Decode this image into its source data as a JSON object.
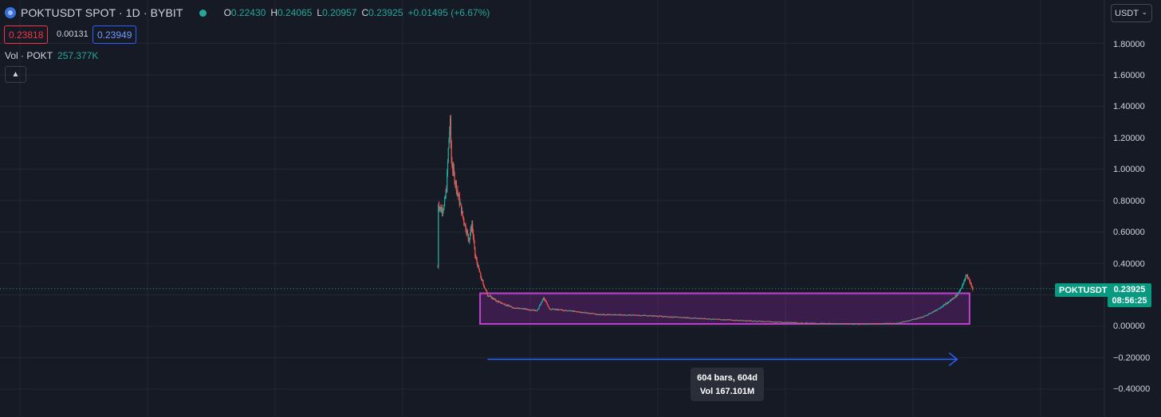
{
  "header": {
    "title": "POKTUSDT SPOT · 1D · BYBIT",
    "ohlc": [
      {
        "key": "O",
        "value": "0.22430"
      },
      {
        "key": "H",
        "value": "0.24065"
      },
      {
        "key": "L",
        "value": "0.20957"
      },
      {
        "key": "C",
        "value": "0.23925"
      }
    ],
    "change": "+0.01495 (+6.67%)"
  },
  "prices": {
    "bid": "0.23818",
    "spread": "0.00131",
    "ask": "0.23949"
  },
  "volume": {
    "label": "Vol · POKT",
    "value": "257.377K"
  },
  "currency": {
    "selected": "USDT"
  },
  "price_axis": {
    "ticks": [
      "1.80000",
      "1.60000",
      "1.40000",
      "1.20000",
      "1.00000",
      "0.80000",
      "0.60000",
      "0.40000",
      "0.20000",
      "0.00000",
      "−0.20000",
      "−0.40000"
    ]
  },
  "last_price": {
    "symbol": "POKTUSDT",
    "price": "0.23925",
    "countdown": "08:56:25"
  },
  "measure": {
    "bars": "604 bars, 604d",
    "volume": "Vol 167.101M"
  },
  "colors": {
    "background": "#161a25",
    "up": "#26a69a",
    "down": "#ef5350",
    "range_box": "#c040d0",
    "arrow": "#2962ff",
    "price_label": "#089981"
  },
  "chart_data": {
    "type": "candlestick",
    "symbol": "POKTUSDT",
    "interval": "1D",
    "ylim": [
      -0.5,
      1.95
    ],
    "grid": true,
    "last": 0.23925,
    "series": [
      {
        "bar": 0,
        "price": 0.38
      },
      {
        "bar": 1,
        "price": 0.78
      },
      {
        "bar": 5,
        "price": 0.74
      },
      {
        "bar": 10,
        "price": 0.76
      },
      {
        "bar": 14,
        "price": 0.88
      },
      {
        "bar": 18,
        "price": 1.2
      },
      {
        "bar": 20,
        "price": 1.29
      },
      {
        "bar": 22,
        "price": 1.05
      },
      {
        "bar": 26,
        "price": 0.96
      },
      {
        "bar": 32,
        "price": 0.85
      },
      {
        "bar": 40,
        "price": 0.7
      },
      {
        "bar": 50,
        "price": 0.55
      },
      {
        "bar": 55,
        "price": 0.65
      },
      {
        "bar": 60,
        "price": 0.45
      },
      {
        "bar": 70,
        "price": 0.3
      },
      {
        "bar": 80,
        "price": 0.2
      },
      {
        "bar": 95,
        "price": 0.16
      },
      {
        "bar": 120,
        "price": 0.12
      },
      {
        "bar": 160,
        "price": 0.1
      },
      {
        "bar": 170,
        "price": 0.18
      },
      {
        "bar": 180,
        "price": 0.11
      },
      {
        "bar": 210,
        "price": 0.1
      },
      {
        "bar": 260,
        "price": 0.075
      },
      {
        "bar": 330,
        "price": 0.07
      },
      {
        "bar": 400,
        "price": 0.055
      },
      {
        "bar": 500,
        "price": 0.035
      },
      {
        "bar": 600,
        "price": 0.02
      },
      {
        "bar": 680,
        "price": 0.015
      },
      {
        "bar": 740,
        "price": 0.02
      },
      {
        "bar": 780,
        "price": 0.06
      },
      {
        "bar": 800,
        "price": 0.1
      },
      {
        "bar": 820,
        "price": 0.15
      },
      {
        "bar": 835,
        "price": 0.2
      },
      {
        "bar": 845,
        "price": 0.27
      },
      {
        "bar": 850,
        "price": 0.33
      },
      {
        "bar": 860,
        "price": 0.24
      }
    ],
    "range_box": {
      "bar_start": 68,
      "bar_end": 855,
      "price_top": 0.21,
      "price_bottom": 0.015
    },
    "measure_arrow": {
      "bar_start": 80,
      "bar_end": 835,
      "price": -0.21
    }
  }
}
